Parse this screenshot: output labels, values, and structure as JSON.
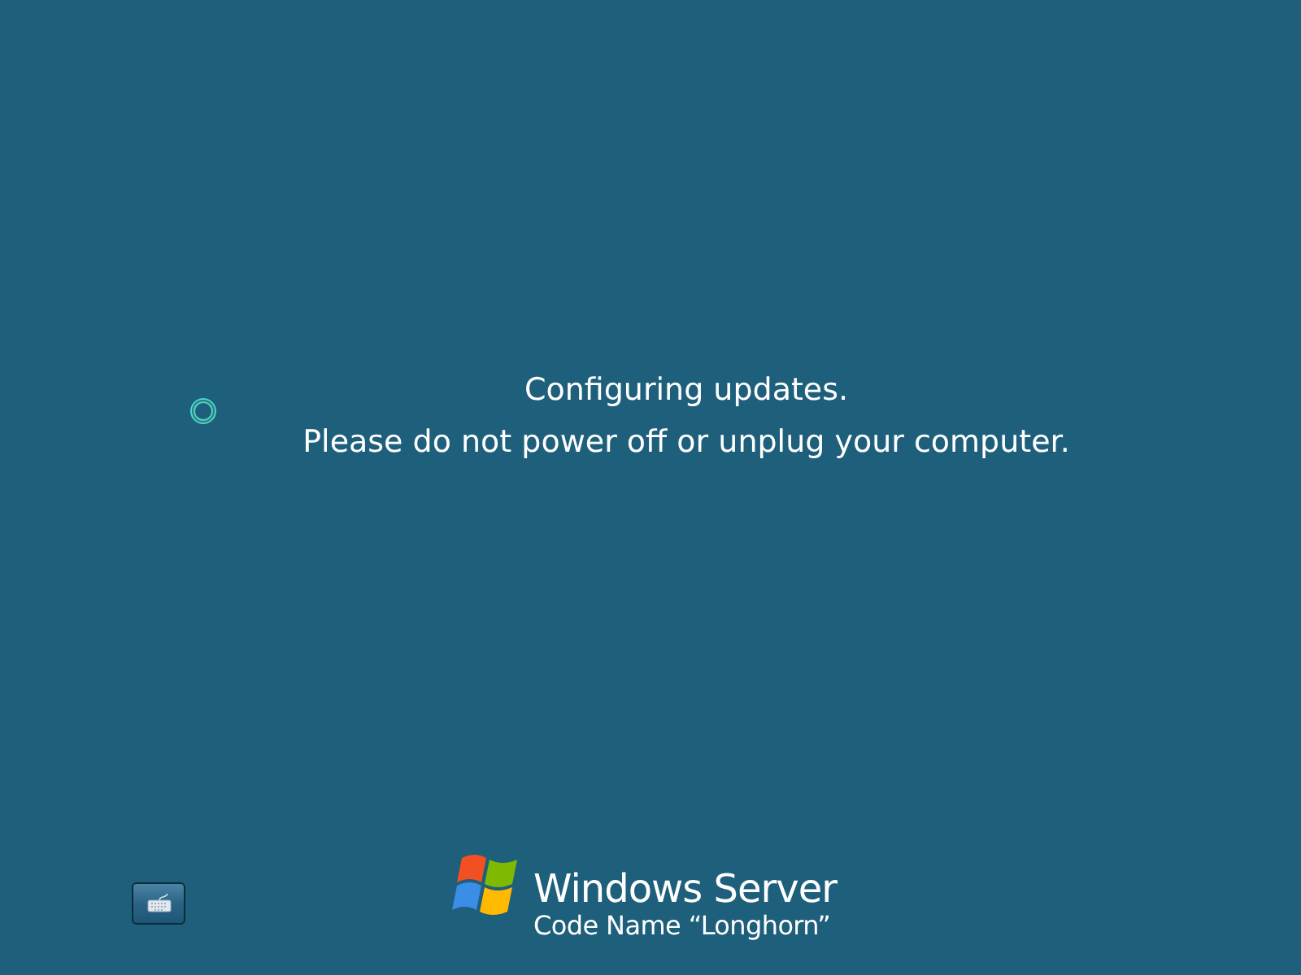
{
  "status": {
    "lines": [
      "Configuring updates.",
      "Please do not power off or unplug your computer."
    ]
  },
  "branding": {
    "product": "Windows Server",
    "subtitle": "Code Name “Longhorn”"
  }
}
